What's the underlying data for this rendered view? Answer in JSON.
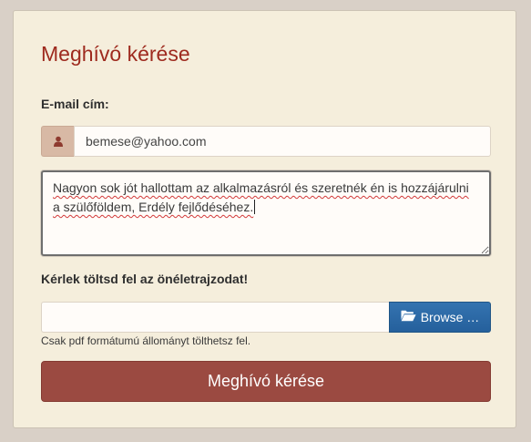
{
  "form": {
    "title": "Meghívó kérése",
    "email_label": "E-mail cím:",
    "email_value": "bemese@yahoo.com",
    "message_value": "Nagyon sok jót hallottam az alkalmazásról és szeretnék én is hozzájárulni a szülőföldem, Erdély fejlődéséhez.",
    "upload_label": "Kérlek töltsd fel az önéletrajzodat!",
    "file_value": "",
    "browse_label": "Browse …",
    "hint": "Csak pdf formátumú állományt tölthetsz fel.",
    "submit_label": "Meghívó kérése"
  },
  "icons": {
    "email_addon": "user-icon",
    "browse": "folder-open-icon"
  },
  "colors": {
    "title": "#9e2a1e",
    "submit": "#9b4a41",
    "browse": "#2c6aa8",
    "panel": "#f5eedc"
  }
}
